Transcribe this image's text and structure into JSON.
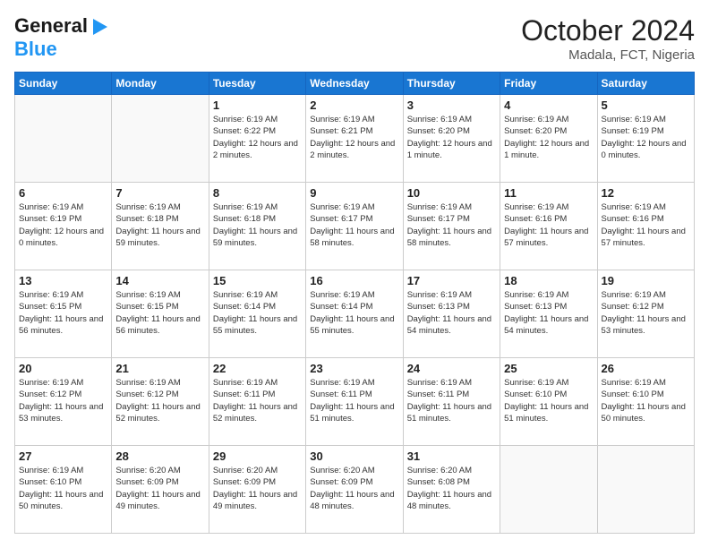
{
  "header": {
    "logo_general": "General",
    "logo_blue": "Blue",
    "month_title": "October 2024",
    "location": "Madala, FCT, Nigeria"
  },
  "weekdays": [
    "Sunday",
    "Monday",
    "Tuesday",
    "Wednesday",
    "Thursday",
    "Friday",
    "Saturday"
  ],
  "weeks": [
    [
      {
        "day": "",
        "info": ""
      },
      {
        "day": "",
        "info": ""
      },
      {
        "day": "1",
        "info": "Sunrise: 6:19 AM\nSunset: 6:22 PM\nDaylight: 12 hours\nand 2 minutes."
      },
      {
        "day": "2",
        "info": "Sunrise: 6:19 AM\nSunset: 6:21 PM\nDaylight: 12 hours\nand 2 minutes."
      },
      {
        "day": "3",
        "info": "Sunrise: 6:19 AM\nSunset: 6:20 PM\nDaylight: 12 hours\nand 1 minute."
      },
      {
        "day": "4",
        "info": "Sunrise: 6:19 AM\nSunset: 6:20 PM\nDaylight: 12 hours\nand 1 minute."
      },
      {
        "day": "5",
        "info": "Sunrise: 6:19 AM\nSunset: 6:19 PM\nDaylight: 12 hours\nand 0 minutes."
      }
    ],
    [
      {
        "day": "6",
        "info": "Sunrise: 6:19 AM\nSunset: 6:19 PM\nDaylight: 12 hours\nand 0 minutes."
      },
      {
        "day": "7",
        "info": "Sunrise: 6:19 AM\nSunset: 6:18 PM\nDaylight: 11 hours\nand 59 minutes."
      },
      {
        "day": "8",
        "info": "Sunrise: 6:19 AM\nSunset: 6:18 PM\nDaylight: 11 hours\nand 59 minutes."
      },
      {
        "day": "9",
        "info": "Sunrise: 6:19 AM\nSunset: 6:17 PM\nDaylight: 11 hours\nand 58 minutes."
      },
      {
        "day": "10",
        "info": "Sunrise: 6:19 AM\nSunset: 6:17 PM\nDaylight: 11 hours\nand 58 minutes."
      },
      {
        "day": "11",
        "info": "Sunrise: 6:19 AM\nSunset: 6:16 PM\nDaylight: 11 hours\nand 57 minutes."
      },
      {
        "day": "12",
        "info": "Sunrise: 6:19 AM\nSunset: 6:16 PM\nDaylight: 11 hours\nand 57 minutes."
      }
    ],
    [
      {
        "day": "13",
        "info": "Sunrise: 6:19 AM\nSunset: 6:15 PM\nDaylight: 11 hours\nand 56 minutes."
      },
      {
        "day": "14",
        "info": "Sunrise: 6:19 AM\nSunset: 6:15 PM\nDaylight: 11 hours\nand 56 minutes."
      },
      {
        "day": "15",
        "info": "Sunrise: 6:19 AM\nSunset: 6:14 PM\nDaylight: 11 hours\nand 55 minutes."
      },
      {
        "day": "16",
        "info": "Sunrise: 6:19 AM\nSunset: 6:14 PM\nDaylight: 11 hours\nand 55 minutes."
      },
      {
        "day": "17",
        "info": "Sunrise: 6:19 AM\nSunset: 6:13 PM\nDaylight: 11 hours\nand 54 minutes."
      },
      {
        "day": "18",
        "info": "Sunrise: 6:19 AM\nSunset: 6:13 PM\nDaylight: 11 hours\nand 54 minutes."
      },
      {
        "day": "19",
        "info": "Sunrise: 6:19 AM\nSunset: 6:12 PM\nDaylight: 11 hours\nand 53 minutes."
      }
    ],
    [
      {
        "day": "20",
        "info": "Sunrise: 6:19 AM\nSunset: 6:12 PM\nDaylight: 11 hours\nand 53 minutes."
      },
      {
        "day": "21",
        "info": "Sunrise: 6:19 AM\nSunset: 6:12 PM\nDaylight: 11 hours\nand 52 minutes."
      },
      {
        "day": "22",
        "info": "Sunrise: 6:19 AM\nSunset: 6:11 PM\nDaylight: 11 hours\nand 52 minutes."
      },
      {
        "day": "23",
        "info": "Sunrise: 6:19 AM\nSunset: 6:11 PM\nDaylight: 11 hours\nand 51 minutes."
      },
      {
        "day": "24",
        "info": "Sunrise: 6:19 AM\nSunset: 6:11 PM\nDaylight: 11 hours\nand 51 minutes."
      },
      {
        "day": "25",
        "info": "Sunrise: 6:19 AM\nSunset: 6:10 PM\nDaylight: 11 hours\nand 51 minutes."
      },
      {
        "day": "26",
        "info": "Sunrise: 6:19 AM\nSunset: 6:10 PM\nDaylight: 11 hours\nand 50 minutes."
      }
    ],
    [
      {
        "day": "27",
        "info": "Sunrise: 6:19 AM\nSunset: 6:10 PM\nDaylight: 11 hours\nand 50 minutes."
      },
      {
        "day": "28",
        "info": "Sunrise: 6:20 AM\nSunset: 6:09 PM\nDaylight: 11 hours\nand 49 minutes."
      },
      {
        "day": "29",
        "info": "Sunrise: 6:20 AM\nSunset: 6:09 PM\nDaylight: 11 hours\nand 49 minutes."
      },
      {
        "day": "30",
        "info": "Sunrise: 6:20 AM\nSunset: 6:09 PM\nDaylight: 11 hours\nand 48 minutes."
      },
      {
        "day": "31",
        "info": "Sunrise: 6:20 AM\nSunset: 6:08 PM\nDaylight: 11 hours\nand 48 minutes."
      },
      {
        "day": "",
        "info": ""
      },
      {
        "day": "",
        "info": ""
      }
    ]
  ]
}
